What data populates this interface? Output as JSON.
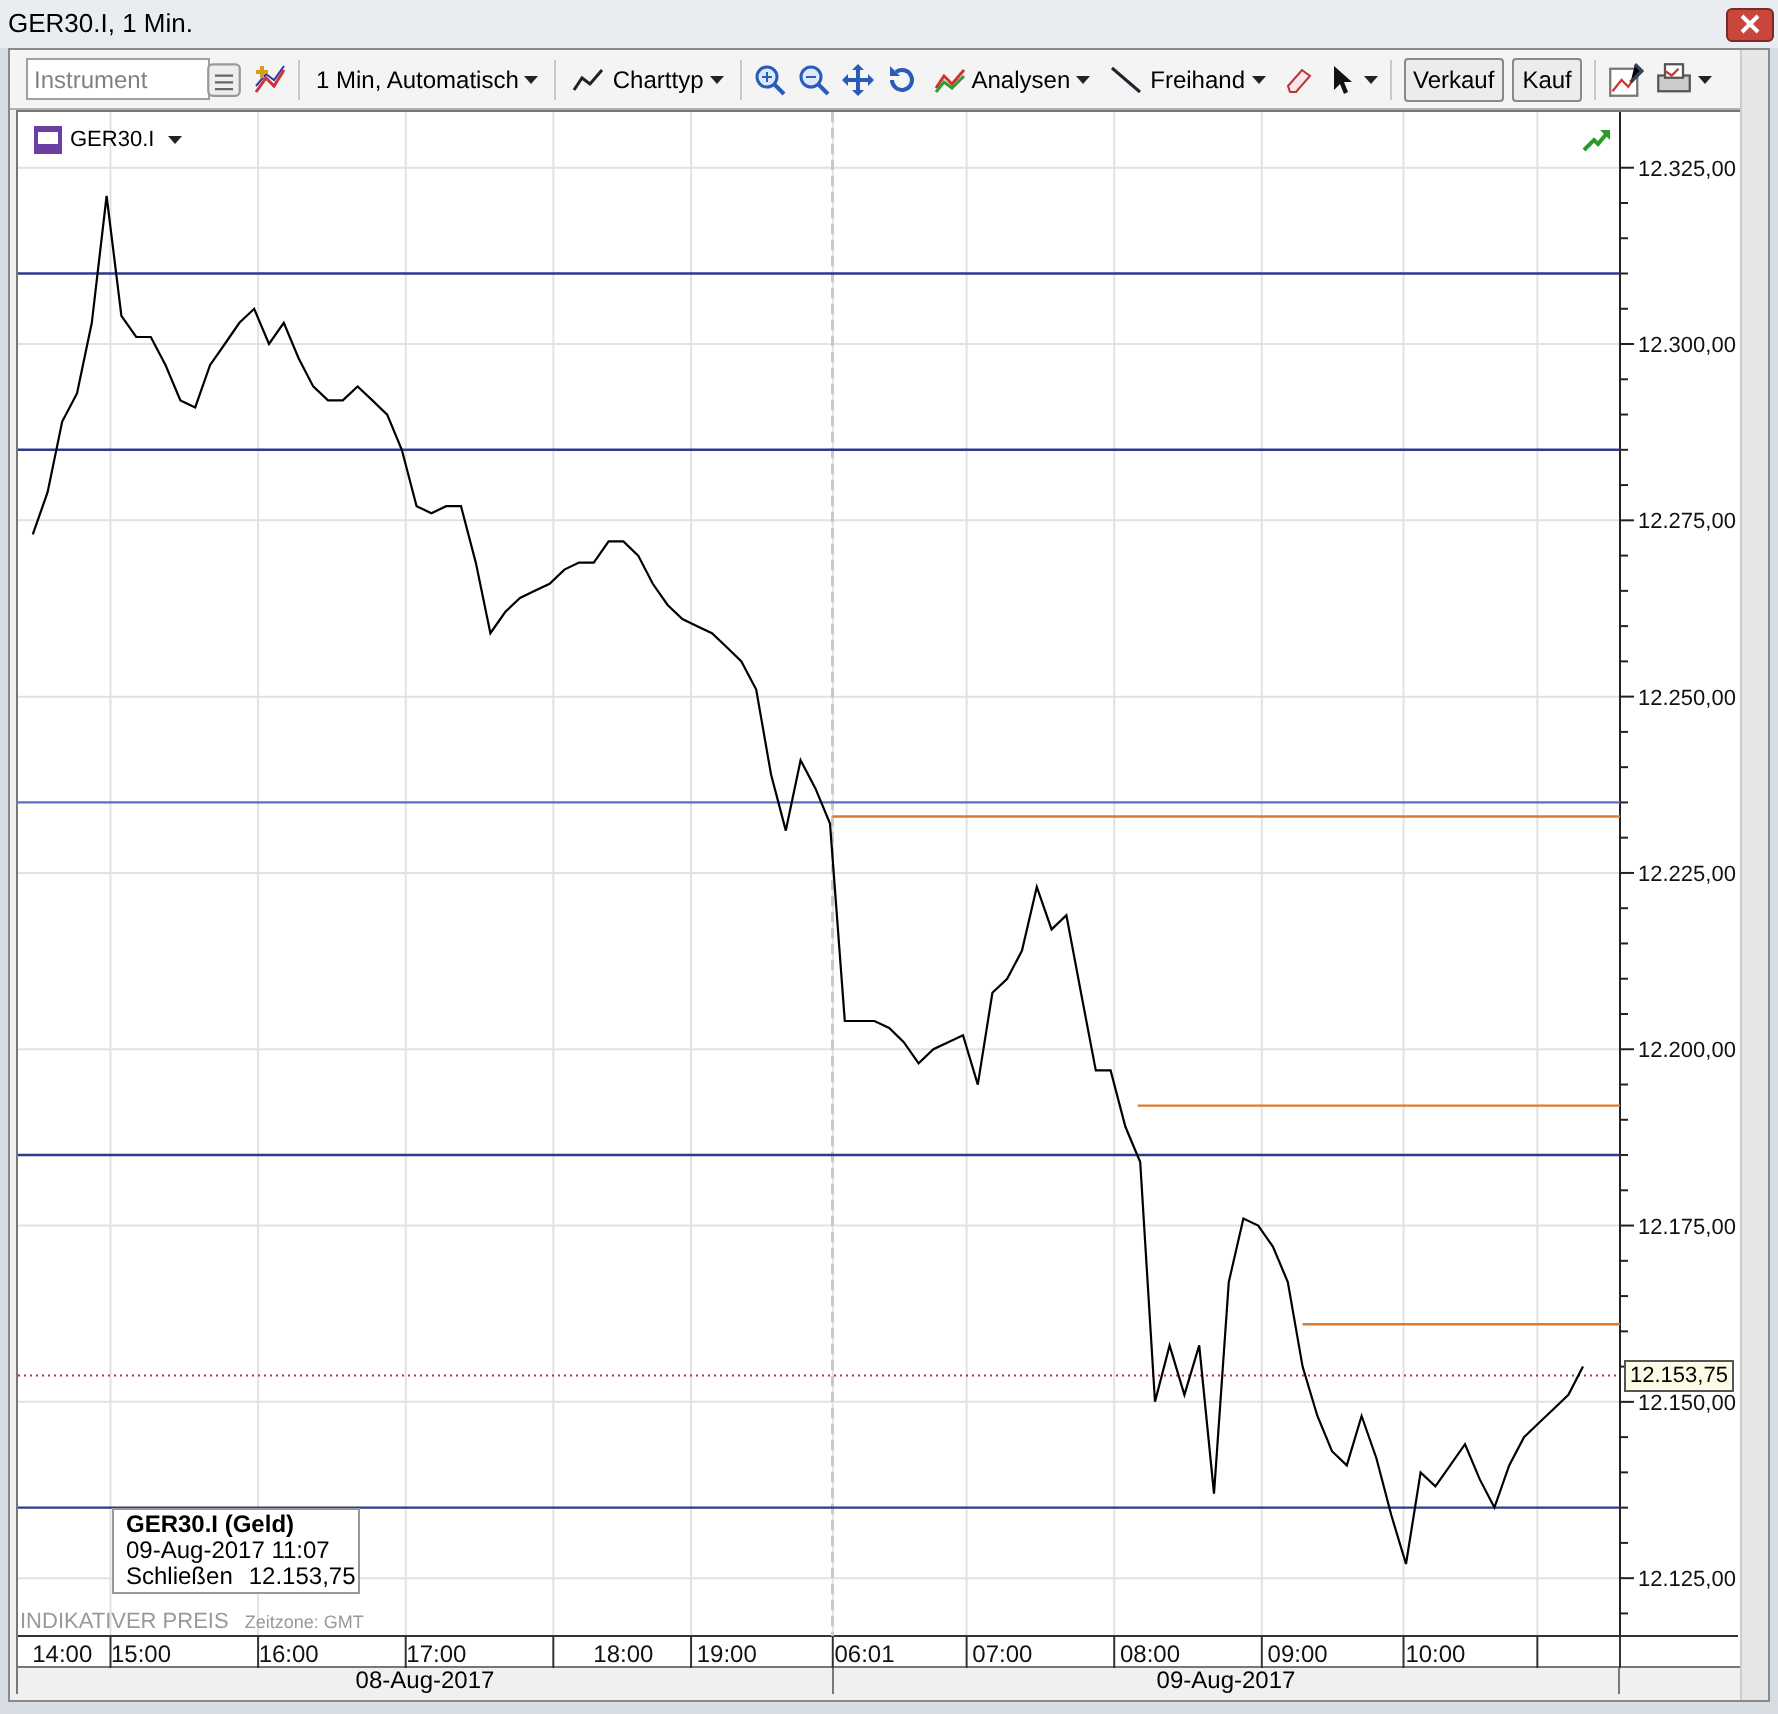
{
  "window": {
    "title": "GER30.I, 1 Min."
  },
  "toolbar": {
    "instrument": {
      "placeholder": "Instrument"
    },
    "interval": "1 Min,  Automatisch",
    "chart_type": "Charttyp",
    "analyses": "Analysen",
    "drawing": "Freihand",
    "sell": "Verkauf",
    "buy": "Kauf"
  },
  "chart": {
    "info_box": {
      "title": "GER30.I (Geld)",
      "date": "09-Aug-2017 11:07",
      "label": "Schließen",
      "value": "12.153,75"
    },
    "price_note": "INDIKATIVER PREIS",
    "timezone": "Zeitzone: GMT",
    "chart_data": {
      "type": "line",
      "ylim": [
        12116.8,
        12332.9
      ],
      "categories": [
        null,
        null,
        null,
        null,
        null,
        null,
        null,
        null,
        null,
        null,
        null,
        null,
        null,
        null,
        null,
        null,
        null,
        null,
        null,
        null,
        null,
        null,
        null,
        null,
        null,
        null,
        null,
        null,
        null,
        null,
        null,
        null,
        null,
        null,
        null,
        null,
        null,
        null,
        null,
        null,
        null,
        null,
        null,
        null,
        null,
        null,
        null,
        null,
        null,
        null,
        null,
        null,
        null,
        null,
        null,
        null,
        null,
        null,
        null,
        null,
        null,
        null,
        null,
        null,
        null,
        null,
        null,
        null,
        null,
        null,
        null,
        null,
        null,
        null,
        null,
        null,
        null,
        null,
        null,
        null,
        null,
        null,
        null,
        null,
        null,
        null,
        null,
        null,
        null,
        null,
        null,
        null,
        null,
        null,
        null,
        null,
        null,
        null,
        null,
        null,
        null,
        null,
        null,
        null,
        null,
        null
      ],
      "yticks": [
        {
          "value": 12125,
          "label": "12.125,00"
        },
        {
          "value": 12150,
          "label": "12.150,00"
        },
        {
          "value": 12175,
          "label": "12.175,00"
        },
        {
          "value": 12200,
          "label": "12.200,00"
        },
        {
          "value": 12225,
          "label": "12.225,00"
        },
        {
          "value": 12250,
          "label": "12.250,00"
        },
        {
          "value": 12275,
          "label": "12.275,00"
        },
        {
          "value": 12300,
          "label": "12.300,00"
        },
        {
          "value": 12325,
          "label": "12.325,00"
        }
      ],
      "series": [
        {
          "name": "GER30.I",
          "color": "#000000",
          "values": [
            12273,
            12279,
            12289,
            12293,
            12303,
            12321,
            12304,
            12301,
            12301,
            12297,
            12292,
            12291,
            12297,
            12300,
            12303,
            12305,
            12300,
            12303,
            12298,
            12294,
            12292,
            12292,
            12294,
            12292,
            12290,
            12285,
            12277,
            12276,
            12277,
            12277,
            12269,
            12259,
            12262,
            12264,
            12265,
            12266,
            12268,
            12269,
            12269,
            12272,
            12272,
            12270,
            12266,
            12263,
            12261,
            12260,
            12259,
            12257,
            12255,
            12251,
            12239,
            12231,
            12241,
            12237,
            12232,
            12204,
            12204,
            12204,
            12203,
            12201,
            12198,
            12200,
            12201,
            12202,
            12195,
            12208,
            12210,
            12214,
            12223,
            12217,
            12219,
            12208,
            12197,
            12197,
            12189,
            12184,
            12150,
            12158,
            12151,
            12158,
            12137,
            12167,
            12176,
            12175,
            12172,
            12167,
            12155,
            12148,
            12143,
            12141,
            12148,
            12142,
            12134,
            12127,
            12140,
            12138,
            12141,
            12144,
            12139,
            12135,
            12141,
            12145,
            12147,
            12149,
            12151,
            12155
          ]
        }
      ],
      "ref_lines": [
        {
          "axis": "y",
          "value": 12310,
          "color": "#2e3a8c"
        },
        {
          "axis": "y",
          "value": 12285,
          "color": "#2e3a8c"
        },
        {
          "axis": "y",
          "value": 12235,
          "color": "#5a6fc0"
        },
        {
          "axis": "y",
          "value": 12185,
          "color": "#2e3a8c"
        },
        {
          "axis": "y",
          "value": 12135,
          "color": "#2e3a8c"
        },
        {
          "axis": "y",
          "value": 12233,
          "color": "#e07a2a"
        },
        {
          "axis": "y",
          "value": 12192,
          "color": "#e07a2a"
        },
        {
          "axis": "y",
          "value": 12161,
          "color": "#e07a2a"
        },
        {
          "axis": "y",
          "value": 12153.75,
          "label": "12.153,75",
          "color": "#c03030"
        }
      ],
      "grid": true
    }
  },
  "time_axis": [
    "14:00",
    "15:00",
    "16:00",
    "17:00",
    "18:00",
    "19:00",
    "06:01",
    "07:00",
    "08:00",
    "09:00",
    "10:00"
  ],
  "date_axis": [
    "08-Aug-2017",
    "09-Aug-2017"
  ]
}
